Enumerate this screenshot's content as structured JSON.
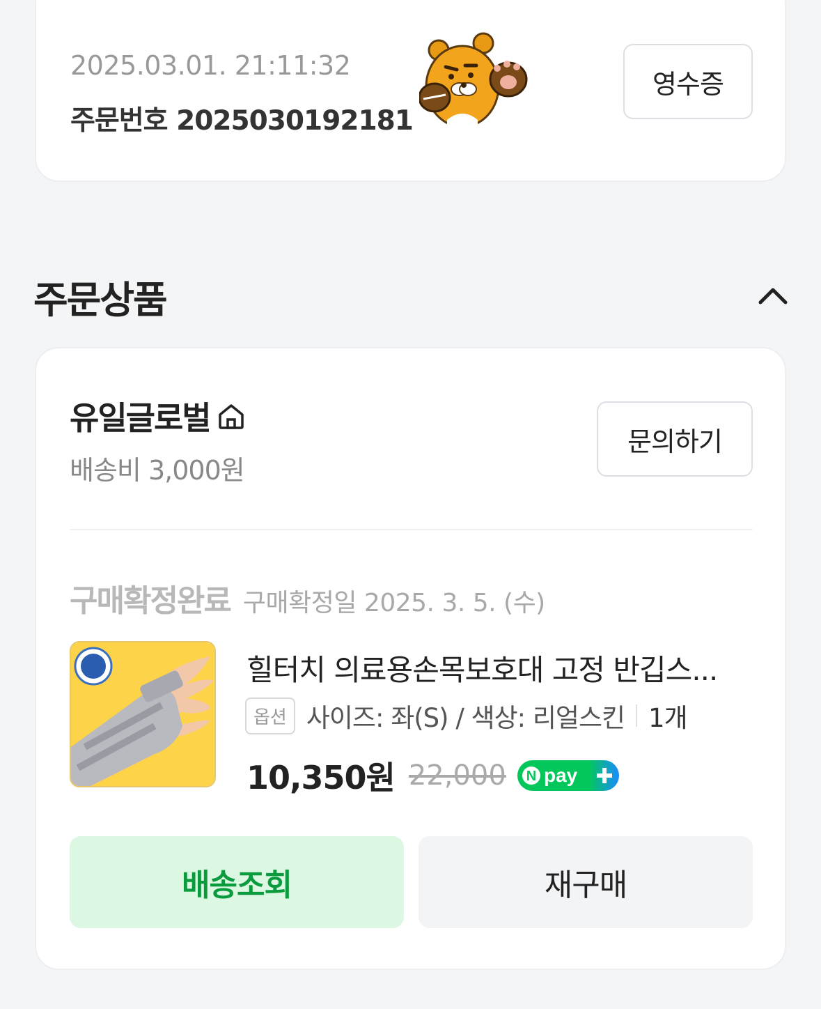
{
  "order": {
    "datetime": "2025.03.01. 21:11:32",
    "number": "주문번호 2025030192181",
    "receipt_label": "영수증"
  },
  "section": {
    "title": "주문상품"
  },
  "seller": {
    "name": "유일글로벌",
    "shipping_fee": "배송비 3,000원",
    "inquiry_label": "문의하기"
  },
  "item": {
    "status": "구매확정완료",
    "confirm_date": "구매확정일 2025. 3. 5. (수)",
    "name": "힐터치 의료용손목보호대 고정 반깁스...",
    "option_badge": "옵션",
    "option_text": "사이즈: 좌(S) / 색상: 리얼스킨",
    "quantity": "1개",
    "sale_price": "10,350원",
    "original_price": "22,000",
    "npay_label": "pay"
  },
  "actions": {
    "track_label": "배송조회",
    "rebuy_label": "재구매"
  },
  "colors": {
    "accent_green": "#0b9b3e",
    "track_bg": "#dcf8e2",
    "background": "#f4f5f7"
  }
}
